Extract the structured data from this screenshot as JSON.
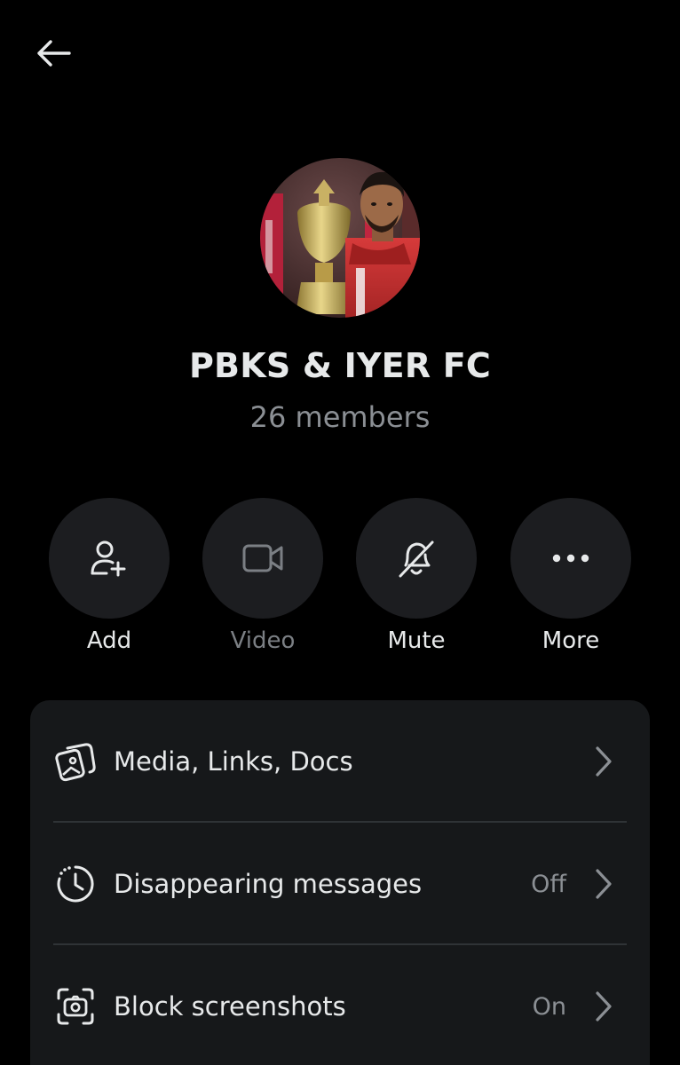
{
  "header": {
    "back_icon": "arrow-left-icon"
  },
  "group": {
    "name": "PBKS & IYER FC",
    "members": "26 members"
  },
  "actions": [
    {
      "label": "Add",
      "icon": "add-person-icon",
      "enabled": true
    },
    {
      "label": "Video",
      "icon": "video-camera-icon",
      "enabled": false
    },
    {
      "label": "Mute",
      "icon": "bell-off-icon",
      "enabled": true
    },
    {
      "label": "More",
      "icon": "more-dots-icon",
      "enabled": true
    }
  ],
  "settings": [
    {
      "label": "Media, Links, Docs",
      "value": "",
      "icon": "media-gallery-icon"
    },
    {
      "label": "Disappearing messages",
      "value": "Off",
      "icon": "timer-icon"
    },
    {
      "label": "Block screenshots",
      "value": "On",
      "icon": "screenshot-icon"
    }
  ],
  "colors": {
    "background": "#000000",
    "card": "#16181a",
    "action_circle": "#1c1d20",
    "text_primary": "#e7e9ea",
    "text_secondary": "#8b8f94",
    "divider": "#2f3336"
  }
}
